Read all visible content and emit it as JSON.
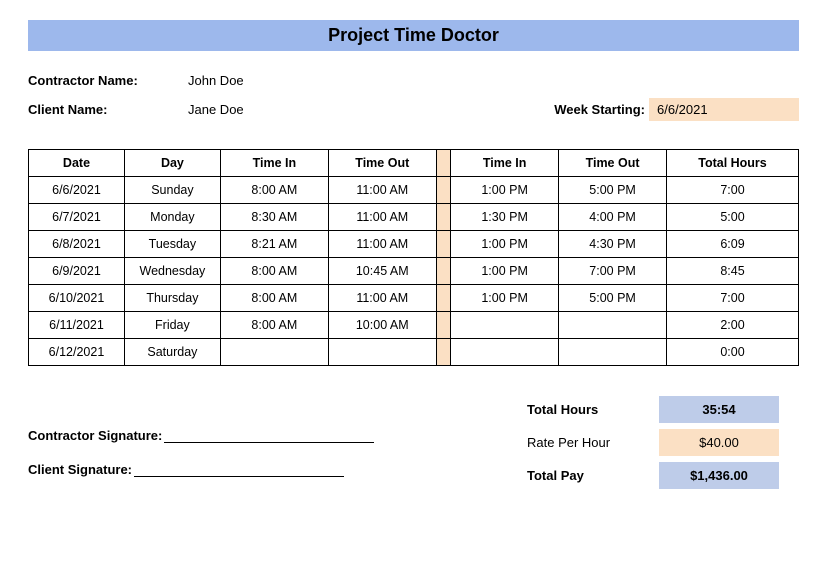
{
  "title": "Project Time Doctor",
  "contractor_label": "Contractor Name:",
  "contractor_name": "John Doe",
  "client_label": "Client Name:",
  "client_name": "Jane Doe",
  "week_label": "Week Starting:",
  "week_value": "6/6/2021",
  "headers": {
    "date": "Date",
    "day": "Day",
    "time_in": "Time In",
    "time_out": "Time Out",
    "total": "Total Hours"
  },
  "rows": [
    {
      "date": "6/6/2021",
      "day": "Sunday",
      "in1": "8:00 AM",
      "out1": "11:00 AM",
      "in2": "1:00 PM",
      "out2": "5:00 PM",
      "total": "7:00"
    },
    {
      "date": "6/7/2021",
      "day": "Monday",
      "in1": "8:30 AM",
      "out1": "11:00 AM",
      "in2": "1:30 PM",
      "out2": "4:00 PM",
      "total": "5:00"
    },
    {
      "date": "6/8/2021",
      "day": "Tuesday",
      "in1": "8:21 AM",
      "out1": "11:00 AM",
      "in2": "1:00 PM",
      "out2": "4:30 PM",
      "total": "6:09"
    },
    {
      "date": "6/9/2021",
      "day": "Wednesday",
      "in1": "8:00 AM",
      "out1": "10:45 AM",
      "in2": "1:00 PM",
      "out2": "7:00 PM",
      "total": "8:45"
    },
    {
      "date": "6/10/2021",
      "day": "Thursday",
      "in1": "8:00 AM",
      "out1": "11:00 AM",
      "in2": "1:00 PM",
      "out2": "5:00 PM",
      "total": "7:00"
    },
    {
      "date": "6/11/2021",
      "day": "Friday",
      "in1": "8:00 AM",
      "out1": "10:00 AM",
      "in2": "",
      "out2": "",
      "total": "2:00"
    },
    {
      "date": "6/12/2021",
      "day": "Saturday",
      "in1": "",
      "out1": "",
      "in2": "",
      "out2": "",
      "total": "0:00"
    }
  ],
  "summary": {
    "total_hours_label": "Total Hours",
    "total_hours_value": "35:54",
    "rate_label": "Rate Per Hour",
    "rate_value": "$40.00",
    "pay_label": "Total Pay",
    "pay_value": "$1,436.00"
  },
  "contractor_sig_label": "Contractor Signature:",
  "client_sig_label": "Client Signature:"
}
